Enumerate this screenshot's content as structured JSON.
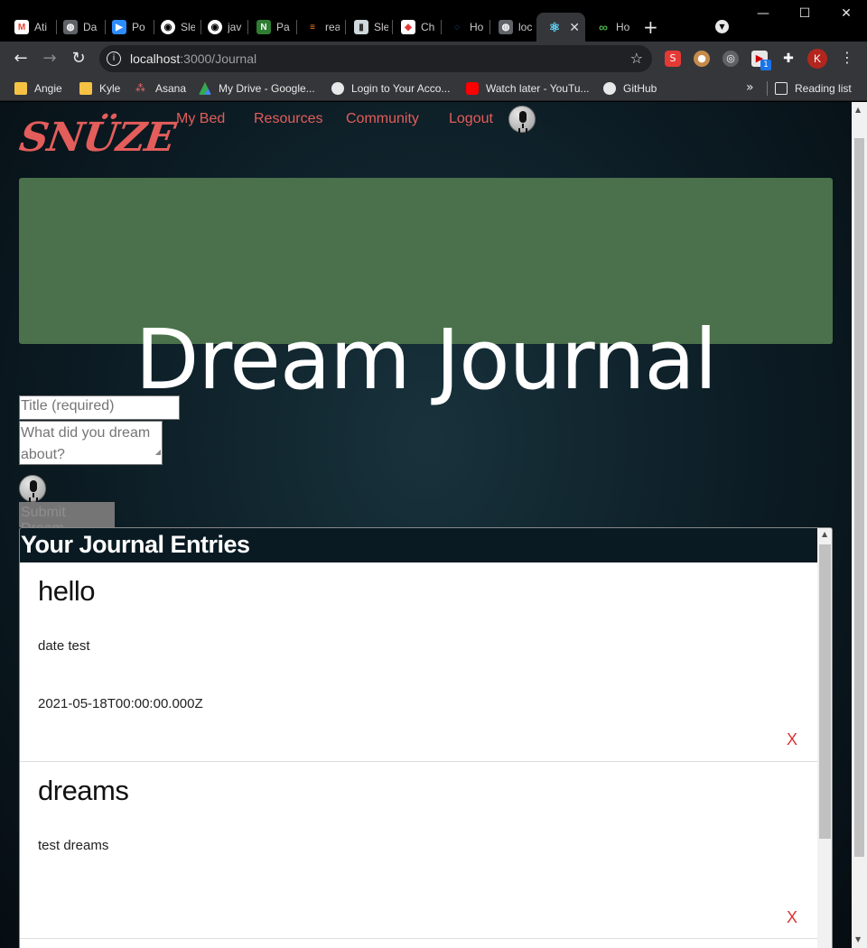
{
  "browser": {
    "tabs": [
      {
        "label": "Ati",
        "icon": "gmail-icon",
        "color": "#ea4335",
        "glyph": "M"
      },
      {
        "label": "Da",
        "icon": "globe-icon",
        "color": "#5f6368",
        "glyph": "◍"
      },
      {
        "label": "Po",
        "icon": "zoom-icon",
        "color": "#2d8cff",
        "glyph": "▶"
      },
      {
        "label": "Sle",
        "icon": "github-icon",
        "color": "#24292e",
        "glyph": "◉"
      },
      {
        "label": "jav",
        "icon": "github-icon",
        "color": "#24292e",
        "glyph": "◉"
      },
      {
        "label": "Pa",
        "icon": "pa-icon",
        "color": "#2e7d32",
        "glyph": "N"
      },
      {
        "label": "rea",
        "icon": "stackoverflow-icon",
        "color": "#f48024",
        "glyph": "≡"
      },
      {
        "label": "Sle",
        "icon": "book-icon",
        "color": "#607d8b",
        "glyph": "▮"
      },
      {
        "label": "Ch",
        "icon": "box-icon",
        "color": "#e53935",
        "glyph": "◆"
      },
      {
        "label": "Ho",
        "icon": "loader-icon",
        "color": "#1e88e5",
        "glyph": "◌"
      },
      {
        "label": "loc",
        "icon": "globe-icon",
        "color": "#5f6368",
        "glyph": "◍"
      },
      {
        "label": "",
        "icon": "react-icon",
        "color": "#61dafb",
        "glyph": "⚛",
        "active": true
      },
      {
        "label": "Ho",
        "icon": "infinity-icon",
        "color": "#4caf50",
        "glyph": "∞"
      }
    ],
    "url_host": "localhost",
    "url_path": ":3000/Journal",
    "bookmarks": [
      {
        "label": "Angie",
        "icon": "folder-icon",
        "color": "#f6c244"
      },
      {
        "label": "Kyle",
        "icon": "folder-icon",
        "color": "#f6c244"
      },
      {
        "label": "Asana",
        "icon": "asana-icon",
        "color": "#f06a6a"
      },
      {
        "label": "My Drive - Google...",
        "icon": "drive-icon",
        "color": "#34a853"
      },
      {
        "label": "Login to Your Acco...",
        "icon": "globe-icon",
        "color": "#e8e8e8"
      },
      {
        "label": "Watch later - YouTu...",
        "icon": "youtube-icon",
        "color": "#ff0000"
      },
      {
        "label": "GitHub",
        "icon": "github-icon",
        "color": "#e8e8e8"
      }
    ],
    "reading_list": "Reading list",
    "profile_initial": "K",
    "extension_badge": "1"
  },
  "nav": {
    "logo": "SNÜZE",
    "links": [
      "My Bed",
      "Resources",
      "Community",
      "Logout"
    ]
  },
  "hero": {
    "title": "Dream Journal",
    "banner_color": "#4a714b"
  },
  "form": {
    "title_placeholder": "Title (required)",
    "dream_placeholder": "What did you dream about?",
    "submit_label": "Submit Dream"
  },
  "entries": {
    "heading": "Your Journal Entries",
    "items": [
      {
        "title": "hello",
        "body": "date test",
        "date": "2021-05-18T00:00:00.000Z",
        "delete": "X"
      },
      {
        "title": "dreams",
        "body": "test dreams",
        "date": "",
        "delete": "X"
      }
    ]
  },
  "colors": {
    "accent": "#e35d5b",
    "page_bg": "#0c1c24"
  }
}
